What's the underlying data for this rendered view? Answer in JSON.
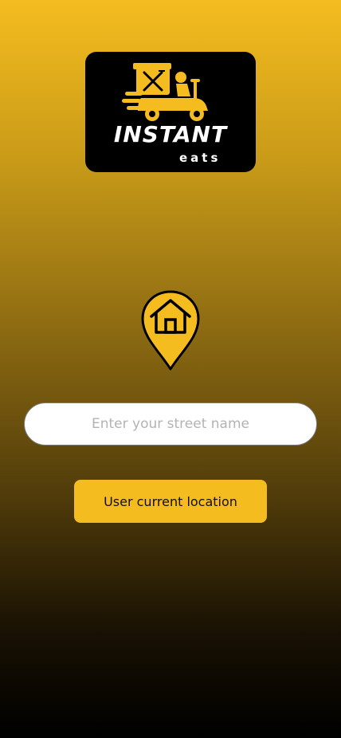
{
  "logo": {
    "brand": "INSTANT",
    "sub": "eats",
    "icon": "delivery-scooter-icon"
  },
  "pin": {
    "icon": "home-location-pin-icon"
  },
  "street_input": {
    "value": "",
    "placeholder": "Enter your street name"
  },
  "location_button": {
    "label": "User current location"
  },
  "colors": {
    "accent": "#F4BC1F",
    "background_top": "#F4BC1F",
    "background_bottom": "#000000",
    "logo_card": "#000000"
  }
}
